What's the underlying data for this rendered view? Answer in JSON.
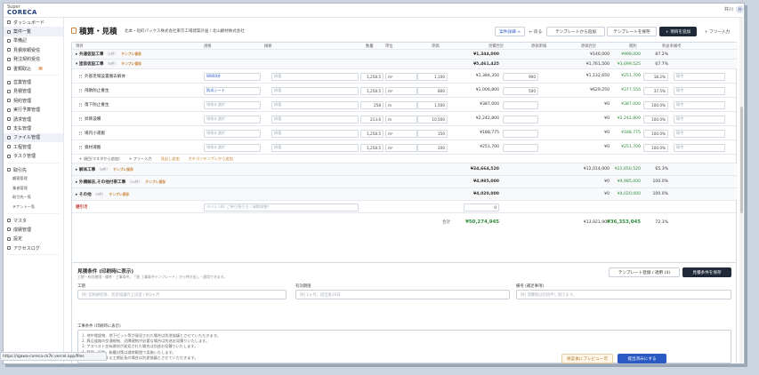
{
  "app": {
    "logo_top": "Super",
    "logo_name": "CORECA",
    "user_name": "井川",
    "avatar": "井"
  },
  "sidebar": {
    "items": [
      {
        "label": "ダッシュボード"
      },
      {
        "label": "案件一覧",
        "active": true
      },
      {
        "label": "準備記"
      },
      {
        "label": "見積依頼受信"
      },
      {
        "label": "発注契約受信"
      },
      {
        "label": "書類取込",
        "badge": "5"
      },
      {
        "label": "営業管理"
      },
      {
        "label": "見積管理"
      },
      {
        "label": "契約管理"
      },
      {
        "label": "実行予算管理"
      },
      {
        "label": "請求管理"
      },
      {
        "label": "支払管理"
      },
      {
        "label": "ファイル管理",
        "active": true
      },
      {
        "label": "工程管理"
      },
      {
        "label": "タスク管理"
      },
      {
        "label": "取引先"
      },
      {
        "label": "顧客管理",
        "sub": true
      },
      {
        "label": "業者管理",
        "sub": true
      },
      {
        "label": "取引先一覧",
        "sub": true
      },
      {
        "label": "テナント一覧",
        "sub": true
      },
      {
        "label": "マスタ"
      },
      {
        "label": "成績管理"
      },
      {
        "label": "設定"
      },
      {
        "label": "アクセスログ"
      }
    ]
  },
  "header": {
    "title": "積算・見積",
    "subtitle": "北本・短町パックス株式会社東京工場建築計画 / 北山顧材株式会社",
    "btn_detail": "案件詳細 →",
    "btn_back": "← 戻る",
    "btn_from_template": "テンプレートから追加",
    "btn_save_template": "テンプレートを保存",
    "btn_add_item": "+ 項目を追加",
    "btn_free_input": "+ フリー入力"
  },
  "table": {
    "columns": [
      "項目",
      "規格",
      "摘要",
      "数量",
      "単位",
      "単価",
      "見積合計",
      "原価単価",
      "原価合計",
      "粗利",
      "利益率",
      "備考"
    ],
    "sections": [
      {
        "name": "▸ 共通仮設工事",
        "count": "（1件）",
        "tag": "テンプレ保存",
        "total": "¥1,344,000",
        "cost_total": "¥146,000",
        "profit": "¥998,000",
        "rate": "87.2%",
        "expanded": false
      },
      {
        "name": "▾ 塗装仮設工事",
        "count": "（6件）",
        "tag": "テンプレ保存",
        "total": "¥5,461,425",
        "cost_total": "¥1,761,500",
        "profit": "¥3,699,525",
        "rate": "67.7%",
        "expanded": true
      }
    ],
    "items": [
      {
        "name": "外部足場設置撤去解体",
        "spec": "W800外",
        "spec_ph": false,
        "memo": "摘要",
        "qty": "1,258.5",
        "unit": "m²",
        "price": "1,100",
        "total": "¥1,384,350",
        "cost": "900",
        "cost_total": "¥1,132,650",
        "profit": "¥251,700",
        "rate": "18.2%",
        "note": "備考"
      },
      {
        "name": "飛散防止養生",
        "spec": "防炎シート",
        "spec_ph": false,
        "memo": "摘要",
        "qty": "1,258.5",
        "unit": "m²",
        "price": "800",
        "total": "¥1,006,800",
        "cost": "500",
        "cost_total": "¥629,250",
        "profit": "¥377,550",
        "rate": "37.5%",
        "note": "備考"
      },
      {
        "name": "落下防止養生",
        "spec": "規格を選択",
        "spec_ph": true,
        "memo": "摘要",
        "qty": "258",
        "unit": "m",
        "price": "1,500",
        "total": "¥387,000",
        "cost": "",
        "cost_total": "¥0",
        "profit": "¥387,000",
        "rate": "100.0%",
        "note": "備考"
      },
      {
        "name": "昇降設備",
        "spec": "規格を選択",
        "spec_ph": true,
        "memo": "摘要",
        "qty": "213.6",
        "unit": "m",
        "price": "10,500",
        "total": "¥2,242,800",
        "cost": "",
        "cost_total": "¥0",
        "profit": "¥2,242,800",
        "rate": "100.0%",
        "note": "備考"
      },
      {
        "name": "場内小運搬",
        "spec": "規格を選択",
        "spec_ph": true,
        "memo": "摘要",
        "qty": "1,258.5",
        "unit": "m²",
        "price": "150",
        "total": "¥188,775",
        "cost": "",
        "cost_total": "¥0",
        "profit": "¥188,775",
        "rate": "100.0%",
        "note": "備考"
      },
      {
        "name": "資材運搬",
        "spec": "規格を選択",
        "spec_ph": true,
        "memo": "摘要",
        "qty": "1,258.5",
        "unit": "m²",
        "price": "200",
        "total": "¥251,700",
        "cost": "",
        "cost_total": "¥0",
        "profit": "¥251,700",
        "rate": "100.0%",
        "note": "備考"
      }
    ],
    "add_links": [
      "+ 項目(マスタから追加)",
      "+ フリー入力",
      "見出し追加",
      "カテゴリテンプレから追加"
    ],
    "sections_after": [
      {
        "name": "▸ 解体工事",
        "count": "（9件）",
        "tag": "テンプレ保存",
        "total": "¥34,664,520",
        "cost_total": "¥12,014,000",
        "profit": "¥22,650,520",
        "rate": "65.3%"
      },
      {
        "name": "▸ 外構解去,その他付帯工事",
        "count": "（10件）",
        "tag": "テンプレ保存",
        "total": "¥4,985,000",
        "cost_total": "¥0",
        "profit": "¥4,985,000",
        "rate": "100.0%"
      },
      {
        "name": "▸ その他",
        "count": "（9件）",
        "tag": "テンプレ保存",
        "total": "¥4,020,000",
        "cost_total": "¥0",
        "profit": "¥4,020,000",
        "rate": "100.0%"
      }
    ],
    "discount": {
      "label": "値引き",
      "placeholder": "ラベル (例: ご単位値引き / 端数調整)",
      "value": "0"
    },
    "totals": {
      "label": "合計",
      "total": "¥50,274,945",
      "cost_total": "¥13,921,900",
      "profit": "¥36,353,045",
      "rate": "72.3%"
    }
  },
  "conditions": {
    "title": "見積条件 (印刷時に表示)",
    "subtitle": "工期・有効期限・備考・工事条件。「直 工事条件テンプレート」から呼び出し・適用できます。",
    "btn_template": "テンプレート登録 / 適用 (4)",
    "btn_save": "見積条件を保存",
    "fields": [
      {
        "label": "工期",
        "placeholder": "例) 契約締結後、別途協議の上決定 / 約3ヶ月"
      },
      {
        "label": "有効期限",
        "placeholder": "例) 1ヶ月、提出後30日"
      },
      {
        "label": "備考 (補足事項)",
        "placeholder": "例) 消費税は別途申し受けます。"
      }
    ],
    "terms_label": "工事条件 (印刷時に表示)",
    "terms": [
      "1. 地中埋設物、地下ピット等が発見された場合は別途協議とさせていただきます。",
      "2. 周辺道路の交通規制、近隣建物が必要な場合は別途お見積りいたします。",
      "3. アスベスト含有建材が発見された場合は別途お見積りいたします。",
      "4. 騒音、振動、粉塵対策は通常範囲で実施いたします。",
      "5. 天候不良による工期延長の場合は別途協議とさせていただきます。"
    ]
  },
  "footer": {
    "status_url": "https://igawa-coreca-ck7k.vercel.app/files",
    "btn_preview": "保証後にプレビュー可",
    "btn_submit": "提出済みにする"
  },
  "colors": {
    "accent": "#2b59c3",
    "profit": "#2e8b3a",
    "tag": "#c77f30",
    "dark": "#1f2937"
  }
}
